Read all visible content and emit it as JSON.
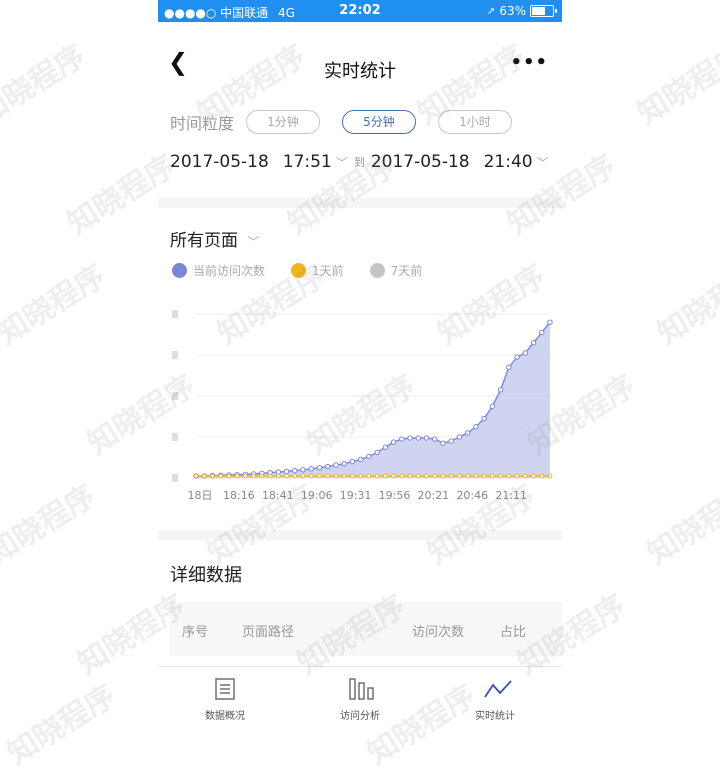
{
  "status_bar": {
    "carrier": "●●●●○ 中国联通",
    "network": "4G",
    "time": "22:02",
    "battery": "63%"
  },
  "navbar": {
    "title": "实时统计",
    "more": "•••"
  },
  "granularity": {
    "label": "时间粒度",
    "options": [
      "1分钟",
      "5分钟",
      "1小时"
    ],
    "selected": "5分钟"
  },
  "time_range": {
    "start_date": "2017-05-18",
    "start_time": "17:51",
    "to": "到",
    "end_date": "2017-05-18",
    "end_time": "21:40"
  },
  "page_filter": "所有页面",
  "colors": {
    "current": "#7b86d6",
    "one_day": "#f2b61c",
    "seven_day": "#c4c4c4",
    "accent": "#1f8ff0"
  },
  "chart_data": {
    "type": "area",
    "x_tick_labels": [
      "18日",
      "18:16",
      "18:41",
      "19:06",
      "19:31",
      "19:56",
      "20:21",
      "20:46",
      "21:11"
    ],
    "series": [
      {
        "name": "当前访问次数",
        "values": [
          1,
          1,
          1.2,
          1.3,
          1.5,
          1.6,
          1.8,
          2,
          2.3,
          2.6,
          2.9,
          3.2,
          3.6,
          4,
          4.5,
          5,
          5.6,
          6.3,
          7,
          8,
          9,
          10.5,
          12.5,
          15,
          17.5,
          19,
          19.5,
          19.5,
          19.5,
          19,
          17,
          18,
          20,
          22,
          25,
          29,
          35,
          43,
          54,
          59,
          61,
          66,
          71,
          76
        ]
      },
      {
        "name": "1天前",
        "values": [
          1,
          1,
          1,
          1,
          1,
          1,
          1,
          1,
          1,
          1,
          1,
          1,
          1,
          1,
          1,
          1,
          1,
          1,
          1,
          1,
          1,
          1,
          1,
          1,
          1,
          1,
          1,
          1,
          1,
          1,
          1,
          1,
          1,
          1,
          1,
          1,
          1,
          1,
          1,
          1,
          1,
          1,
          1,
          1
        ]
      },
      {
        "name": "7天前",
        "values": []
      }
    ],
    "ylim": [
      0,
      80
    ],
    "grid": true
  },
  "detail": {
    "title": "详细数据",
    "columns": [
      "序号",
      "页面路径",
      "访问次数",
      "占比"
    ]
  },
  "tabs": [
    {
      "label": "数据概况"
    },
    {
      "label": "访问分析"
    },
    {
      "label": "实时统计"
    }
  ],
  "watermark": "知晓程序"
}
